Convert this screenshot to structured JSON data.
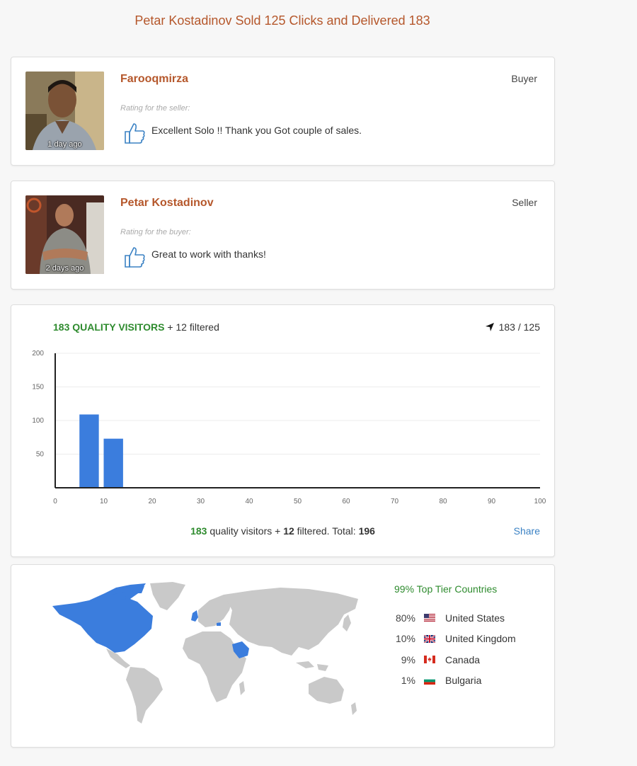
{
  "headline": "Petar Kostadinov Sold 125 Clicks and Delivered 183",
  "reviews": [
    {
      "name": "Farooqmirza",
      "role": "Buyer",
      "time_ago": "1 day ago",
      "rating_caption": "Rating for the seller:",
      "comment": "Excellent Solo !! Thank you Got couple of sales."
    },
    {
      "name": "Petar Kostadinov",
      "role": "Seller",
      "time_ago": "2 days ago",
      "rating_caption": "Rating for the buyer:",
      "comment": "Great to work with thanks!"
    }
  ],
  "visitors": {
    "quality_label": "183 QUALITY VISITORS",
    "filtered_label": "+ 12 filtered",
    "ratio": "183 / 125",
    "summary": {
      "quality_count": "183",
      "quality_text": "quality visitors +",
      "filtered_count": "12",
      "filtered_text": "filtered. Total:",
      "total": "196"
    },
    "share_label": "Share"
  },
  "chart_data": {
    "type": "bar",
    "x": [
      0,
      5,
      10
    ],
    "bar_width": 4,
    "values": [
      1,
      109,
      73
    ],
    "xlim": [
      0,
      100
    ],
    "ylim": [
      0,
      200
    ],
    "x_ticks": [
      0,
      10,
      20,
      30,
      40,
      50,
      60,
      70,
      80,
      90,
      100
    ],
    "y_ticks": [
      50,
      100,
      150,
      200
    ],
    "grid": true,
    "bar_color": "#3b7ddd"
  },
  "geo": {
    "title": "99% Top Tier Countries",
    "highlight_color": "#3b7ddd",
    "countries": [
      {
        "pct": "80%",
        "name": "United States",
        "flag": "us-flag-icon"
      },
      {
        "pct": "10%",
        "name": "United Kingdom",
        "flag": "uk-flag-icon"
      },
      {
        "pct": "9%",
        "name": "Canada",
        "flag": "canada-flag-icon"
      },
      {
        "pct": "1%",
        "name": "Bulgaria",
        "flag": "bulgaria-flag-icon"
      }
    ]
  }
}
